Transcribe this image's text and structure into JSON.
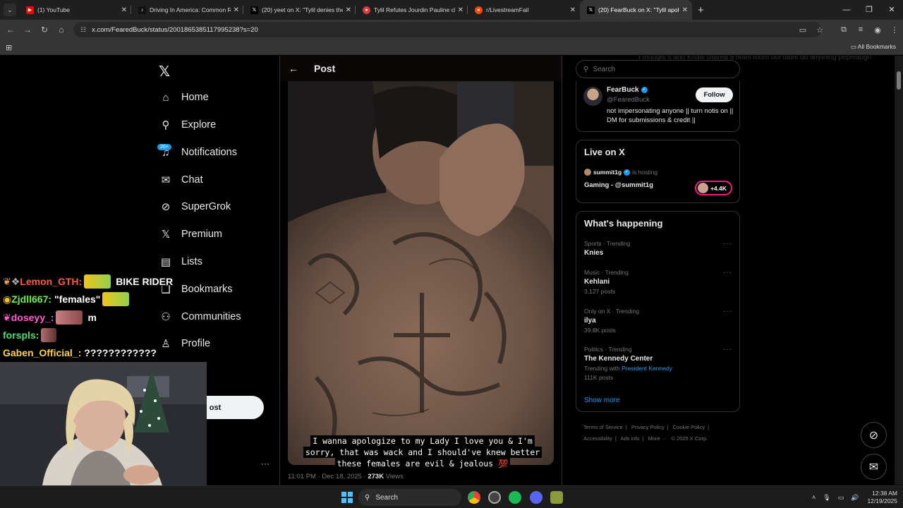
{
  "browser": {
    "tabs": [
      {
        "title": "(1) YouTube",
        "favicon": "youtube",
        "active": false
      },
      {
        "title": "Driving In America: Common R",
        "favicon": "tiktok",
        "active": false
      },
      {
        "title": "(20) yeet on X: \"Tylil denies the",
        "favicon": "x",
        "active": false
      },
      {
        "title": "Tylil Refutes Jourdin Pauline cla",
        "favicon": "reddit-red",
        "active": false
      },
      {
        "title": "r/LivestreamFail",
        "favicon": "reddit",
        "active": false
      },
      {
        "title": "(20) FearBuck on X: \"Tylil apolo",
        "favicon": "x",
        "active": true
      }
    ],
    "url": "x.com/FearedBuck/status/2001865385117995238?s=20",
    "bookmarks_label": "All Bookmarks"
  },
  "sidebar": {
    "items": [
      {
        "label": "Home",
        "icon": "home-icon"
      },
      {
        "label": "Explore",
        "icon": "search-icon"
      },
      {
        "label": "Notifications",
        "icon": "bell-icon"
      },
      {
        "label": "Chat",
        "icon": "mail-icon"
      },
      {
        "label": "SuperGrok",
        "icon": "grok-icon"
      },
      {
        "label": "Premium",
        "icon": "x-icon"
      },
      {
        "label": "Lists",
        "icon": "list-icon"
      },
      {
        "label": "Bookmarks",
        "icon": "bookmark-icon"
      },
      {
        "label": "Communities",
        "icon": "people-icon"
      },
      {
        "label": "Profile",
        "icon": "person-icon"
      }
    ],
    "notification_badge": "20+",
    "post_button": "ost"
  },
  "post": {
    "header": "Post",
    "caption": "I wanna apologize to my Lady I love you & I'm sorry, that was wack and I should've knew better these females are evil & jealous 💯",
    "time": "11:01 PM · Dec 18, 2025 · ",
    "views_count": "273K",
    "views_label": " Views"
  },
  "right": {
    "search_placeholder": "Search",
    "profile": {
      "name": "FearBuck",
      "handle": "@FearedBuck",
      "bio": "not impersonating anyone || turn notis on || DM for submissions & credit ||",
      "follow_label": "Follow"
    },
    "live": {
      "title": "Live on X",
      "host": "summit1g",
      "hosting_text": "is hosting",
      "stream_title": "Gaming - @summit1g",
      "listeners": "+4.4K"
    },
    "whats_happening": {
      "title": "What's happening",
      "trends": [
        {
          "meta": "Sports · Trending",
          "name": "Knies",
          "count": ""
        },
        {
          "meta": "Music · Trending",
          "name": "Kehlani",
          "count": "3,127 posts"
        },
        {
          "meta": "Only on X · Trending",
          "name": "ilya",
          "count": "39.8K posts"
        },
        {
          "meta": "Politics · Trending",
          "name": "The Kennedy Center",
          "count": "111K posts",
          "trending_with": "Trending with",
          "trending_link": "President Kennedy"
        }
      ],
      "show_more": "Show more"
    },
    "footer": [
      "Terms of Service",
      "|",
      "Privacy Policy",
      "|",
      "Cookie Policy",
      "|",
      "Accessibility",
      "|",
      "Ads info",
      "|",
      "More ···",
      "© 2025 X Corp."
    ]
  },
  "chat": [
    {
      "user": "Lemon_GTH:",
      "color": "#ff5a3c",
      "message": "BIKE RIDER"
    },
    {
      "user": "Zjdll667:",
      "color": "#6cf24a",
      "message": "\"females\""
    },
    {
      "user": "doseyy_:",
      "color": "#ff5ad2",
      "message": "m"
    },
    {
      "user": "forspls:",
      "color": "#46e06b",
      "message": ""
    },
    {
      "user": "Gaben_Official_:",
      "color": "#ffd24a",
      "message": "????????????"
    }
  ],
  "ghost_text": "I thought it and Khalil shared a hotel room but didnt do anything pepelaugh",
  "taskbar": {
    "search_label": "Search",
    "time": "12:38 AM",
    "date": "12/19/2025"
  }
}
